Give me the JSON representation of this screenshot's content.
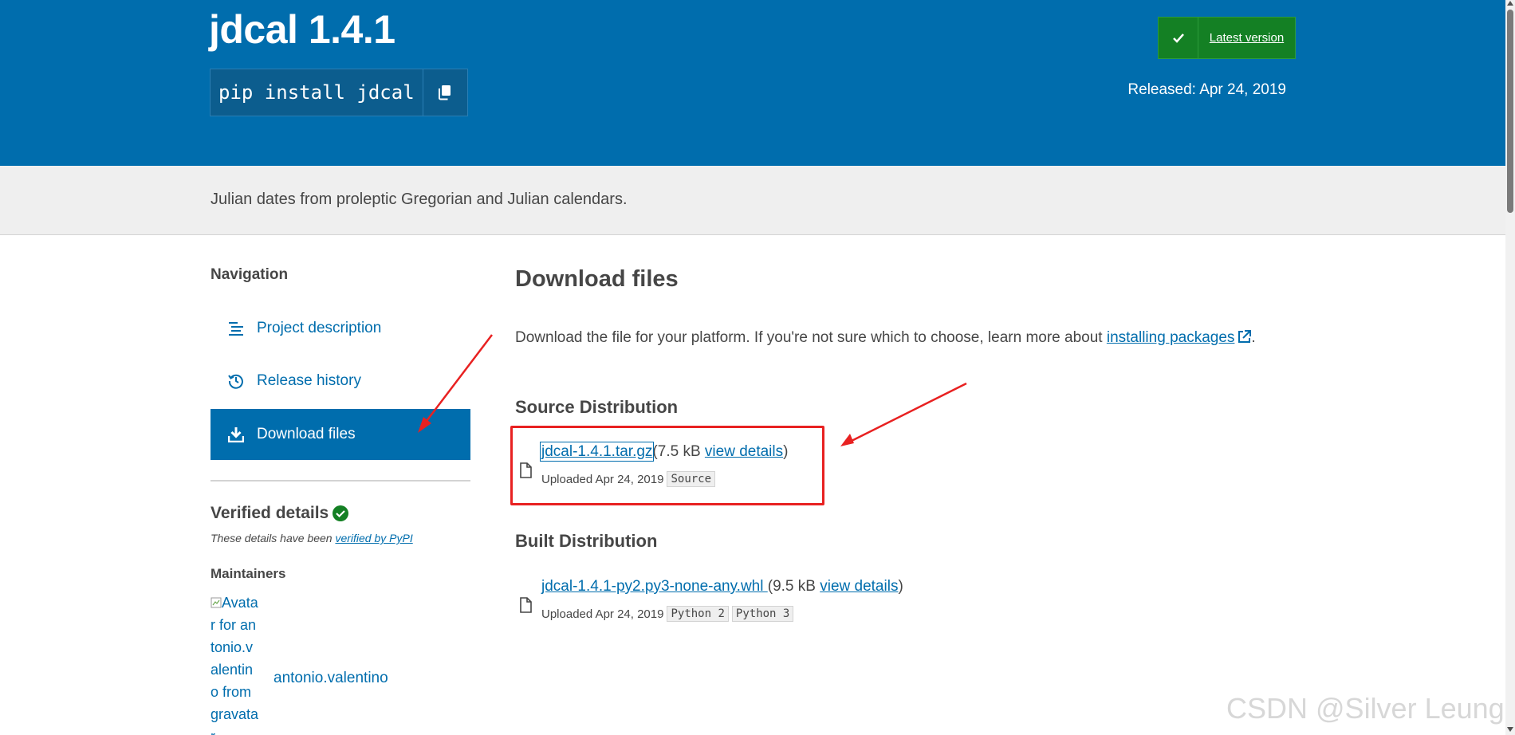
{
  "header": {
    "package_title": "jdcal 1.4.1",
    "pip_command": "pip install jdcal",
    "latest_badge": "Latest version",
    "released": "Released: Apr 24, 2019"
  },
  "summary": "Julian dates from proleptic Gregorian and Julian calendars.",
  "sidebar": {
    "nav_heading": "Navigation",
    "items": [
      {
        "label": "Project description",
        "icon": "align-left-icon",
        "active": false
      },
      {
        "label": "Release history",
        "icon": "history-icon",
        "active": false
      },
      {
        "label": "Download files",
        "icon": "download-icon",
        "active": true
      }
    ],
    "verified_heading": "Verified details",
    "verified_note_prefix": "These details have been ",
    "verified_link": "verified by PyPI",
    "maintainers_heading": "Maintainers",
    "maintainer_avatar_alt": "Avatar for antonio.valentino from gravatar",
    "maintainer_name": "antonio.valentino"
  },
  "main": {
    "title": "Download files",
    "intro_text": "Download the file for your platform. If you're not sure which to choose, learn more about ",
    "intro_link": "installing packages",
    "intro_end": ".",
    "source_heading": "Source Distribution",
    "source_file": {
      "name": "jdcal-1.4.1.tar.gz",
      "size": "(7.5 kB ",
      "details": "view details",
      "close": ")",
      "uploaded": "Uploaded Apr 24, 2019",
      "tags": [
        "Source"
      ]
    },
    "built_heading": "Built Distribution",
    "built_file": {
      "name": "jdcal-1.4.1-py2.py3-none-any.whl ",
      "size": "(9.5 kB ",
      "details": "view details",
      "close": ")",
      "uploaded": "Uploaded Apr 24, 2019",
      "tags": [
        "Python 2",
        "Python 3"
      ]
    }
  },
  "watermark": "CSDN @Silver Leung?",
  "colors": {
    "header_blue": "#006dad",
    "badge_green": "#148024",
    "annotation_red": "#e82121"
  }
}
